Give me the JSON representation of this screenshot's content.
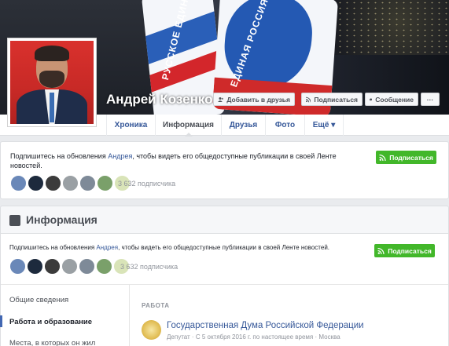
{
  "profile": {
    "name": "Андрей Козенко"
  },
  "cover": {
    "flag1_text": "РУССКОЕ ЕДИНСТВО",
    "flag2_text": "ЕДИНАЯ РОССИЯ"
  },
  "actions": {
    "add_friend": "Добавить в друзья",
    "subscribe": "Подписаться",
    "message": "Сообщение",
    "more": "···"
  },
  "nav": {
    "tabs": [
      {
        "label": "Хроника"
      },
      {
        "label": "Информация"
      },
      {
        "label": "Друзья"
      },
      {
        "label": "Фото"
      },
      {
        "label": "Ещё ▾"
      }
    ]
  },
  "follow_card": {
    "text_prefix": "Подпишитесь на обновления ",
    "text_name": "Андрея",
    "text_suffix": ", чтобы видеть его общедоступные публикации в своей Ленте новостей.",
    "button": "Подписаться",
    "followers": "3 632 подписчика"
  },
  "info": {
    "title": "Информация",
    "follow_text_prefix": "Подпишитесь на обновления ",
    "follow_text_name": "Андрея",
    "follow_text_suffix": ", чтобы видеть его общедоступные публикации в своей Ленте новостей.",
    "follow_button": "Подписаться",
    "followers": "3 632 подписчика",
    "sidebar": [
      {
        "label": "Общие сведения"
      },
      {
        "label": "Работа и образование"
      },
      {
        "label": "Места, в которых он жил"
      }
    ],
    "section_title": "РАБОТА",
    "work": {
      "org": "Государственная Дума Российской Федерации",
      "meta": "Депутат · С 5 октября 2016 г. по настоящее время · Москва"
    }
  },
  "colors": {
    "link": "#365899",
    "green": "#42b72a",
    "background": "#e9ebee",
    "avatar_red": "#d9312d"
  },
  "icons": [
    "add-friend-icon",
    "rss-icon",
    "message-icon",
    "info-icon",
    "gov-emblem-icon"
  ]
}
